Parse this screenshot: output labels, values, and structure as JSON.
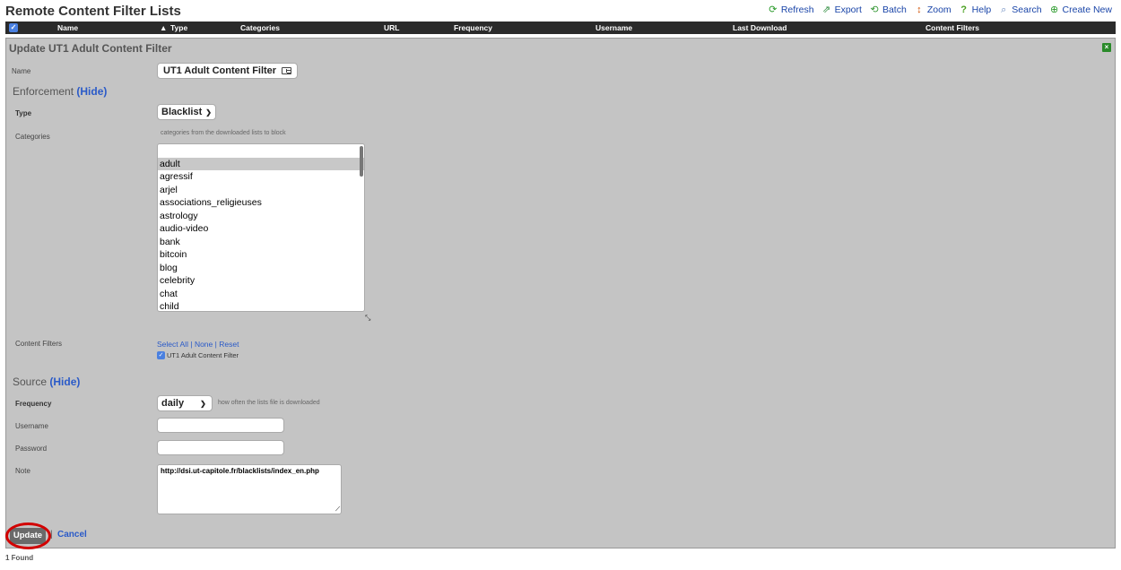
{
  "page": {
    "title": "Remote Content Filter Lists",
    "found": "1 Found"
  },
  "toolbar": {
    "refresh": "Refresh",
    "export": "Export",
    "batch": "Batch",
    "zoom": "Zoom",
    "help": "Help",
    "search": "Search",
    "create_new": "Create New"
  },
  "columns": {
    "name": "Name",
    "type": "Type",
    "categories": "Categories",
    "url": "URL",
    "frequency": "Frequency",
    "username": "Username",
    "last_download": "Last Download",
    "content_filters": "Content Filters",
    "sort_indicator": "▲"
  },
  "form": {
    "title": "Update UT1 Adult Content Filter",
    "name_label": "Name",
    "name_value": "UT1 Adult Content Filter",
    "enforcement": {
      "heading": "Enforcement",
      "hide": "(Hide)"
    },
    "type_label": "Type",
    "type_value": "Blacklist",
    "categories_label": "Categories",
    "categories_hint": "categories from the downloaded lists to block",
    "categories_options": [
      "",
      "adult",
      "agressif",
      "arjel",
      "associations_religieuses",
      "astrology",
      "audio-video",
      "bank",
      "bitcoin",
      "blog",
      "celebrity",
      "chat",
      "child"
    ],
    "categories_selected": "adult",
    "content_filters_label": "Content Filters",
    "select_all": "Select All",
    "none": "None",
    "reset": "Reset",
    "sep": "|",
    "content_filter_item": "UT1 Adult Content Filter",
    "source": {
      "heading": "Source",
      "hide": "(Hide)"
    },
    "frequency_label": "Frequency",
    "frequency_value": "daily",
    "frequency_hint": "how often the lists file is downloaded",
    "username_label": "Username",
    "password_label": "Password",
    "note_label": "Note",
    "note_value": "http://dsi.ut-capitole.fr/blacklists/index_en.php",
    "update_button": "Update",
    "cancel": "Cancel"
  },
  "colors": {
    "panel_bg": "#c4c4c4",
    "link": "#2a5ac8",
    "highlight_ring": "#d20000"
  }
}
